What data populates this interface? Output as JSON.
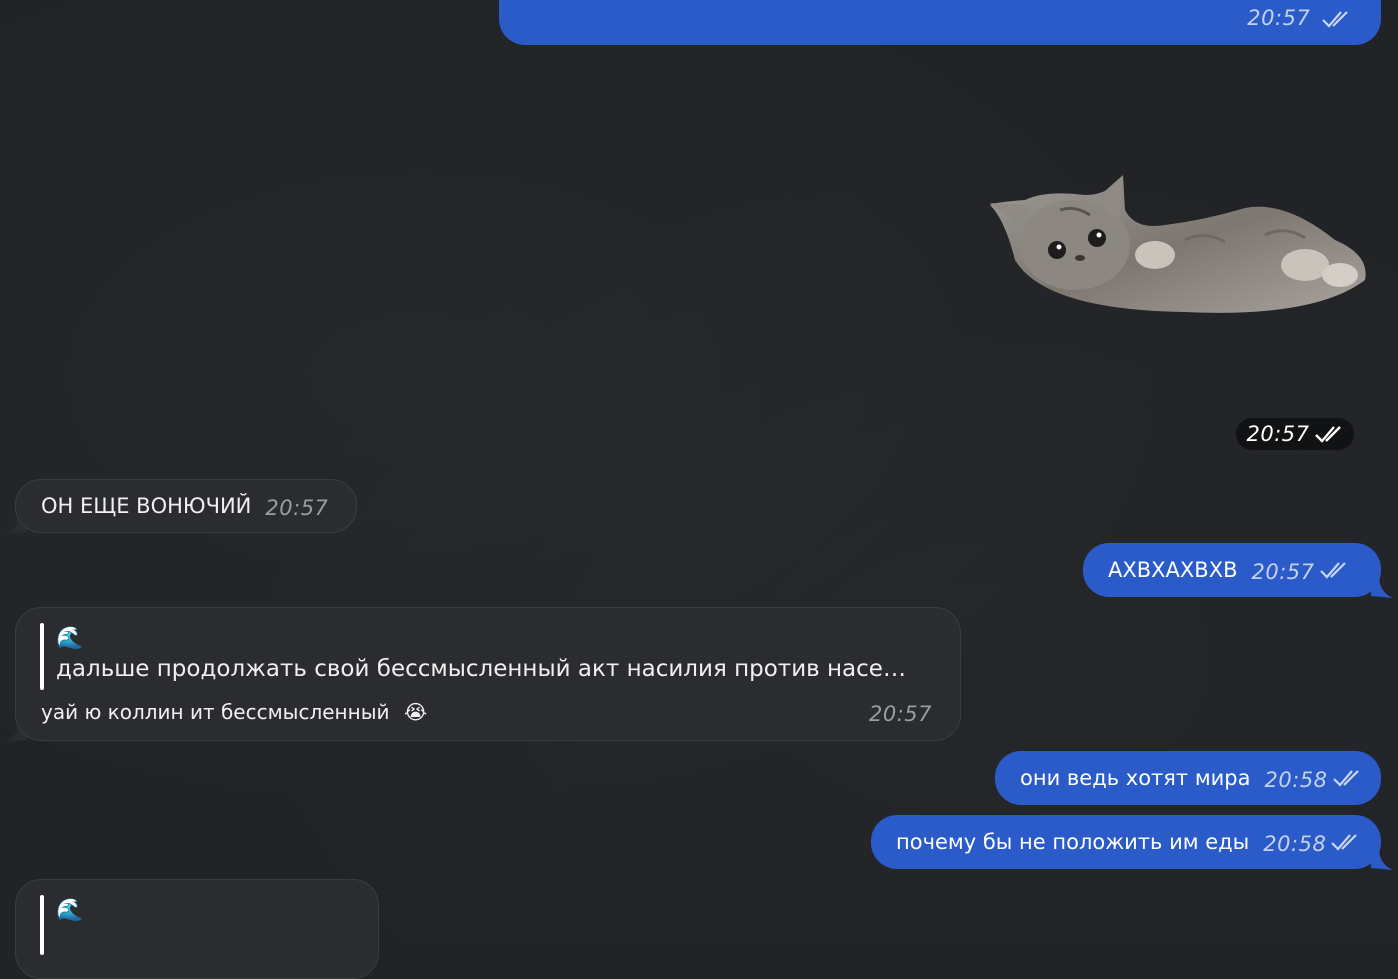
{
  "messages": {
    "m1": {
      "time": "20:57"
    },
    "sticker": {
      "time": "20:57",
      "desc": "cat-sticker"
    },
    "m2": {
      "text": "ОН ЕЩЕ ВОНЮЧИЙ",
      "time": "20:57"
    },
    "m3": {
      "text": "АХВХАХВХВ",
      "time": "20:57"
    },
    "m4": {
      "quote_author_icon": "🌊",
      "quote_text": "дальше продолжать свой бессмысленный акт насилия против насе…",
      "text": "уай ю коллин ит бессмысленный",
      "emoji": "😭",
      "time": "20:57"
    },
    "m5": {
      "text": "они ведь хотят мира",
      "time": "20:58"
    },
    "m6": {
      "text": "почему бы не положить им еды",
      "time": "20:58"
    },
    "m7": {
      "quote_author_icon": "🌊"
    }
  },
  "colors": {
    "background": "#212326",
    "outgoing": "#2a5bc9",
    "incoming": "#2a2c30"
  }
}
